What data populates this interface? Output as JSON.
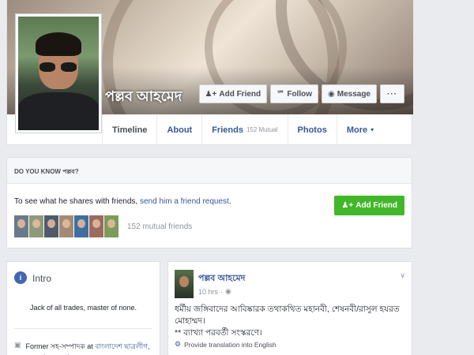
{
  "profile": {
    "name": "পল্লব আহমেদ"
  },
  "cover_actions": {
    "add_friend": "Add Friend",
    "follow": "Follow",
    "message": "Message",
    "more": "···"
  },
  "tabs": [
    {
      "label": "Timeline"
    },
    {
      "label": "About"
    },
    {
      "label": "Friends",
      "sub": "152 Mutual"
    },
    {
      "label": "Photos"
    },
    {
      "label": "More",
      "caret": "▾"
    }
  ],
  "know_card": {
    "heading": "DO YOU KNOW পল্লব?",
    "text_prefix": "To see what he shares with friends, ",
    "link": "send him a friend request",
    "text_suffix": ".",
    "add_friend": "Add Friend",
    "mutual_count": "152 mutual friends",
    "thumb_colors": [
      "#6b7a8a",
      "#8d9a7a",
      "#4d5b6d",
      "#a38a76",
      "#3e6f9e",
      "#9b6b5e",
      "#7d9b5a"
    ]
  },
  "intro": {
    "title": "Intro",
    "icon_letter": "i",
    "bio": "Jack of all trades, master of none.",
    "work_prefix": "Former সহ-সম্পাদক at ",
    "work_link": "বাংলাদেশ ছাত্রলীগ, আরবাইলরপুর উপজেলা শাখা"
  },
  "post": {
    "author": "পল্লব আহমেদ",
    "time": "10 hrs",
    "privacy_icon": "globe-icon",
    "text_line1": "ধর্মীয় জঙ্গিবাদের আবিষ্কারক তথাকথিত মহানবী, শেষনবী/রাসুল হযরত মোহাম্মদ।",
    "text_line2": "** ব্যাখ্যা পরবর্তী সংস্করণে।",
    "translate": "Provide translation into English"
  },
  "colors": {
    "link": "#365899",
    "green": "#42b72a",
    "bg": "#e9ebee"
  }
}
